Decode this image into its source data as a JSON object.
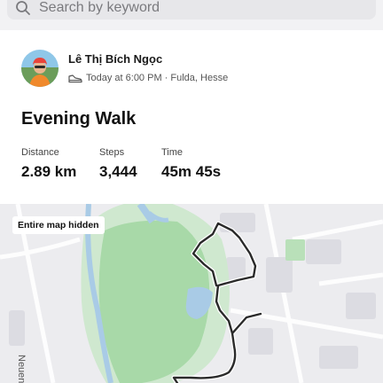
{
  "search": {
    "placeholder": "Search by keyword",
    "icon": "search-icon"
  },
  "activity": {
    "athlete_name": "Lê Thị Bích Ngọc",
    "date_location": "Today at 6:00 PM · Fulda, Hesse",
    "sport_icon": "shoe-icon",
    "title": "Evening Walk",
    "stats": [
      {
        "label": "Distance",
        "value": "2.89 km"
      },
      {
        "label": "Steps",
        "value": "3,444"
      },
      {
        "label": "Time",
        "value": "45m 45s"
      }
    ]
  },
  "map": {
    "badge": "Entire map hidden",
    "street_label": "Neuent",
    "colors": {
      "park": "#a8d9a8",
      "water": "#a9cbe6",
      "route": "#2a2a2a",
      "background": "#ececef"
    }
  }
}
